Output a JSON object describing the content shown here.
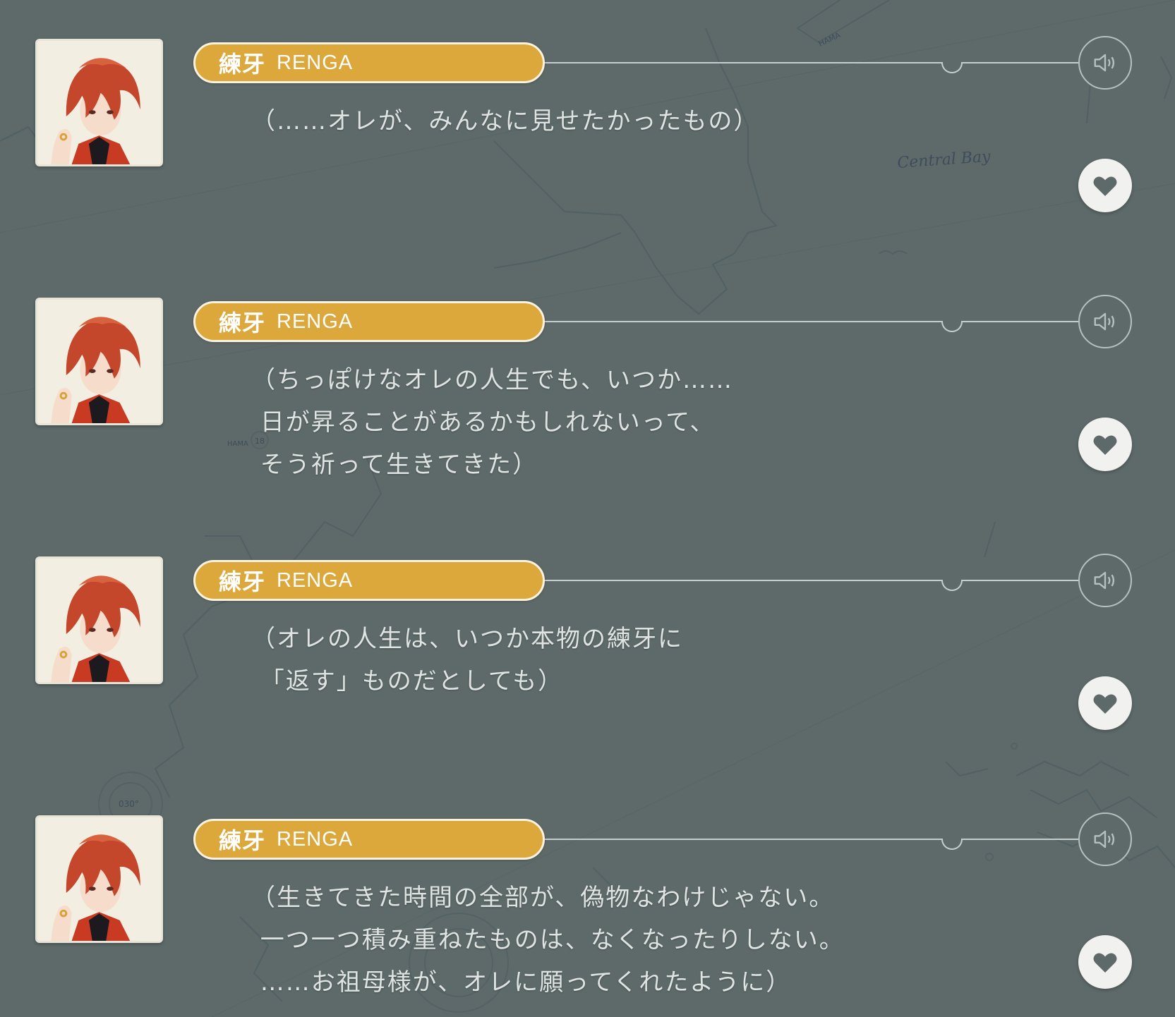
{
  "theme": {
    "background": "#5d6a69",
    "name_pill": "#dca83c",
    "text": "#dfe3e1"
  },
  "map": {
    "label_bay": "Central Bay",
    "label_hama": "HAMA",
    "label_hama2": "HAMA",
    "label_18": "18",
    "label_030": "030°"
  },
  "entries": [
    {
      "speaker_jp": "練牙",
      "speaker_en": "RENGA",
      "text": "（……オレが、みんなに見せたかったもの）",
      "voice_icon": "speaker-icon",
      "favorite_icon": "heart-icon"
    },
    {
      "speaker_jp": "練牙",
      "speaker_en": "RENGA",
      "text": "（ちっぽけなオレの人生でも、いつか……\n 日が昇ることがあるかもしれないって、\n そう祈って生きてきた）",
      "voice_icon": "speaker-icon",
      "favorite_icon": "heart-icon"
    },
    {
      "speaker_jp": "練牙",
      "speaker_en": "RENGA",
      "text": "（オレの人生は、いつか本物の練牙に\n 「返す」ものだとしても）",
      "voice_icon": "speaker-icon",
      "favorite_icon": "heart-icon"
    },
    {
      "speaker_jp": "練牙",
      "speaker_en": "RENGA",
      "text": "（生きてきた時間の全部が、偽物なわけじゃない。\n 一つ一つ積み重ねたものは、なくなったりしない。\n ……お祖母様が、オレに願ってくれたように）",
      "voice_icon": "speaker-icon",
      "favorite_icon": "heart-icon"
    }
  ]
}
